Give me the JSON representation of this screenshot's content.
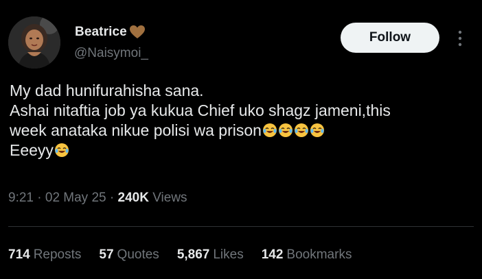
{
  "author": {
    "display_name": "Beatrice",
    "name_emoji": "brown-heart-icon",
    "handle": "@Naisymoi_"
  },
  "follow_button": {
    "label": "Follow"
  },
  "tweet": {
    "lines": [
      "My dad hunifurahisha sana.",
      "Ashai nitaftia job ya kukua Chief uko shagz jameni,this",
      "week anataka nikue polisi wa prison",
      "Eeeyy"
    ],
    "emoji": "face-with-tears-of-joy-icon"
  },
  "meta": {
    "time": "9:21",
    "sep": "·",
    "date": "02 May 25",
    "views_count": "240K",
    "views_label": "Views"
  },
  "stats": {
    "reposts": {
      "count": "714",
      "label": "Reposts"
    },
    "quotes": {
      "count": "57",
      "label": "Quotes"
    },
    "likes": {
      "count": "5,867",
      "label": "Likes"
    },
    "bookmarks": {
      "count": "142",
      "label": "Bookmarks"
    }
  },
  "colors": {
    "background": "#000000",
    "text_primary": "#e7e9ea",
    "text_secondary": "#71767b",
    "follow_bg": "#eff3f4",
    "divider": "#2f3336",
    "heart": "#a0703f",
    "emoji_yellow": "#f7c340"
  }
}
